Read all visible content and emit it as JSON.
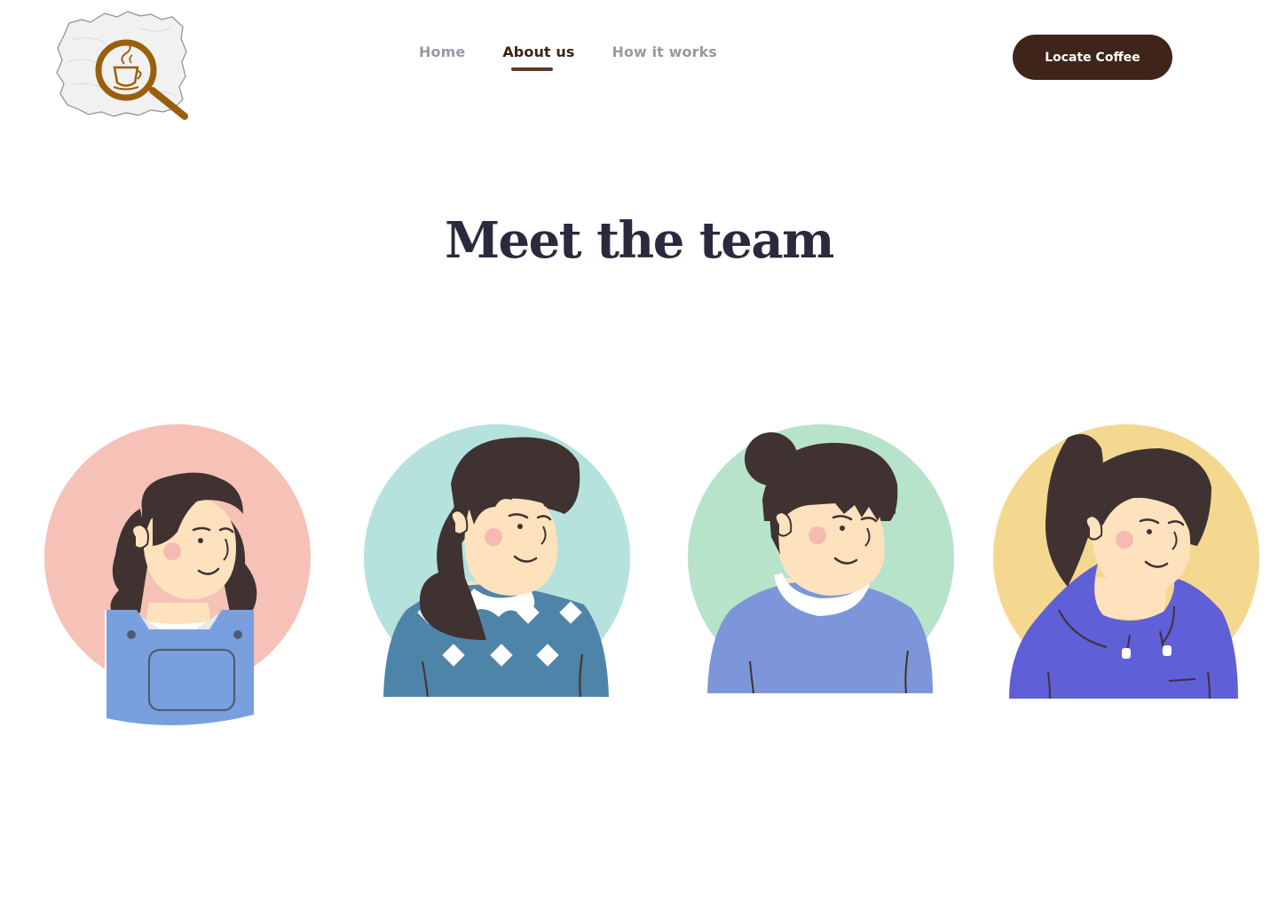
{
  "header": {
    "logo": {
      "icon": "magnifier-coffee-cup-icon",
      "colors": {
        "ring": "#9a5f0c",
        "paper": "#f1f1f1"
      }
    },
    "nav": {
      "items": [
        {
          "label": "Home",
          "active": false
        },
        {
          "label": "About us",
          "active": true
        },
        {
          "label": "How it works",
          "active": false
        }
      ]
    },
    "cta_label": "Locate Coffee"
  },
  "main": {
    "title": "Meet the team",
    "team": [
      {
        "icon": "team-member-1-avatar",
        "background": "#f6c1b7",
        "outfit": "#78a0de"
      },
      {
        "icon": "team-member-2-avatar",
        "background": "#b5e2dc",
        "outfit": "#4f84a9"
      },
      {
        "icon": "team-member-3-avatar",
        "background": "#b7e3cb",
        "outfit": "#7c96d9"
      },
      {
        "icon": "team-member-4-avatar",
        "background": "#f5d890",
        "outfit": "#5f5fd7"
      }
    ]
  },
  "colors": {
    "accent": "#3f2419",
    "title": "#2a2a3f",
    "nav_inactive": "#9a97a3",
    "nav_active": "#3c2415",
    "hair": "#3f3231",
    "skin": "#fde2bd",
    "blush": "#f6b9b4"
  }
}
